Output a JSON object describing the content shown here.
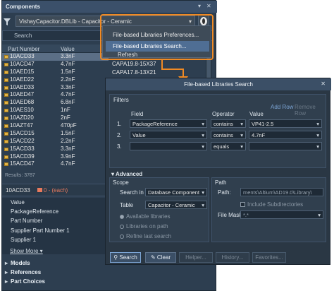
{
  "panel": {
    "title": "Components",
    "library_select": "VishayCapacitor.DBLib - Capacitor - Ceramic",
    "search_placeholder": "Search",
    "columns": [
      "Part Number",
      "Value"
    ],
    "rows": [
      {
        "part": "10ACD33",
        "value": "3.3nF",
        "selected": true
      },
      {
        "part": "10ACD47",
        "value": "4.7nF"
      },
      {
        "part": "10AED15",
        "value": "1.5nF"
      },
      {
        "part": "10AED22",
        "value": "2.2nF"
      },
      {
        "part": "10AED33",
        "value": "3.3nF"
      },
      {
        "part": "10AED47",
        "value": "4.7nF"
      },
      {
        "part": "10AED68",
        "value": "6.8nF"
      },
      {
        "part": "10AES10",
        "value": "1nF"
      },
      {
        "part": "10AZD20",
        "value": "2nF"
      },
      {
        "part": "10AZT47",
        "value": "470pF"
      },
      {
        "part": "15ACD15",
        "value": "1.5nF"
      },
      {
        "part": "15ACD22",
        "value": "2.2nF"
      },
      {
        "part": "15ACD33",
        "value": "3.3nF"
      },
      {
        "part": "15ACD39",
        "value": "3.9nF"
      },
      {
        "part": "15ACD47",
        "value": "4.7nF"
      }
    ],
    "results": "Results: 3787",
    "detail_title": "10ACD33",
    "detail_sub": "0 - (each)",
    "properties": [
      "Value",
      "PackageReference",
      "Part Number",
      "Supplier Part Number 1",
      "Supplier 1"
    ],
    "show_more": "Show More ▾",
    "sections": [
      "Models",
      "References",
      "Part Choices"
    ]
  },
  "menu": {
    "items": [
      "File-based Libraries Preferences...",
      "File-based Libraries Search..."
    ],
    "highlighted_index": 1,
    "refresh": "Refresh",
    "capa_items": [
      "CAPA19.8-15X37",
      "CAPA17.8-13X21"
    ]
  },
  "dialog": {
    "title": "File-based Libraries Search",
    "filters_label": "Filters",
    "add_row": "Add Row",
    "remove_row": "Remove Row",
    "columns": [
      "Field",
      "Operator",
      "Value"
    ],
    "filters": [
      {
        "num": "1.",
        "field": "PackageReference",
        "operator": "contains",
        "value": "VP41-2.5"
      },
      {
        "num": "2.",
        "field": "Value",
        "operator": "contains",
        "value": "4.7nF"
      },
      {
        "num": "3.",
        "field": "",
        "operator": "equals",
        "value": ""
      }
    ],
    "advanced": "Advanced",
    "scope": {
      "label": "Scope",
      "search_in_label": "Search in",
      "search_in_value": "Database Component",
      "table_label": "Table",
      "table_value": "Capacitor - Ceramic",
      "options": [
        "Available libraries",
        "Libraries on path",
        "Refine last search"
      ]
    },
    "path": {
      "label": "Path",
      "path_label": "Path:",
      "path_value": "ments\\Altium\\AD19.0\\Library\\",
      "include_subdirs": "Include Subdirectories",
      "file_mask_label": "File Mask:",
      "file_mask_value": "*.*"
    },
    "buttons": [
      "Search",
      "Clear",
      "Helper...",
      "History...",
      "Favorites..."
    ]
  },
  "colors": {
    "panel_bg": "#2d3e50",
    "highlight": "#4f6e94",
    "callout": "#f08a24",
    "dialog_bg": "#2a3744"
  }
}
